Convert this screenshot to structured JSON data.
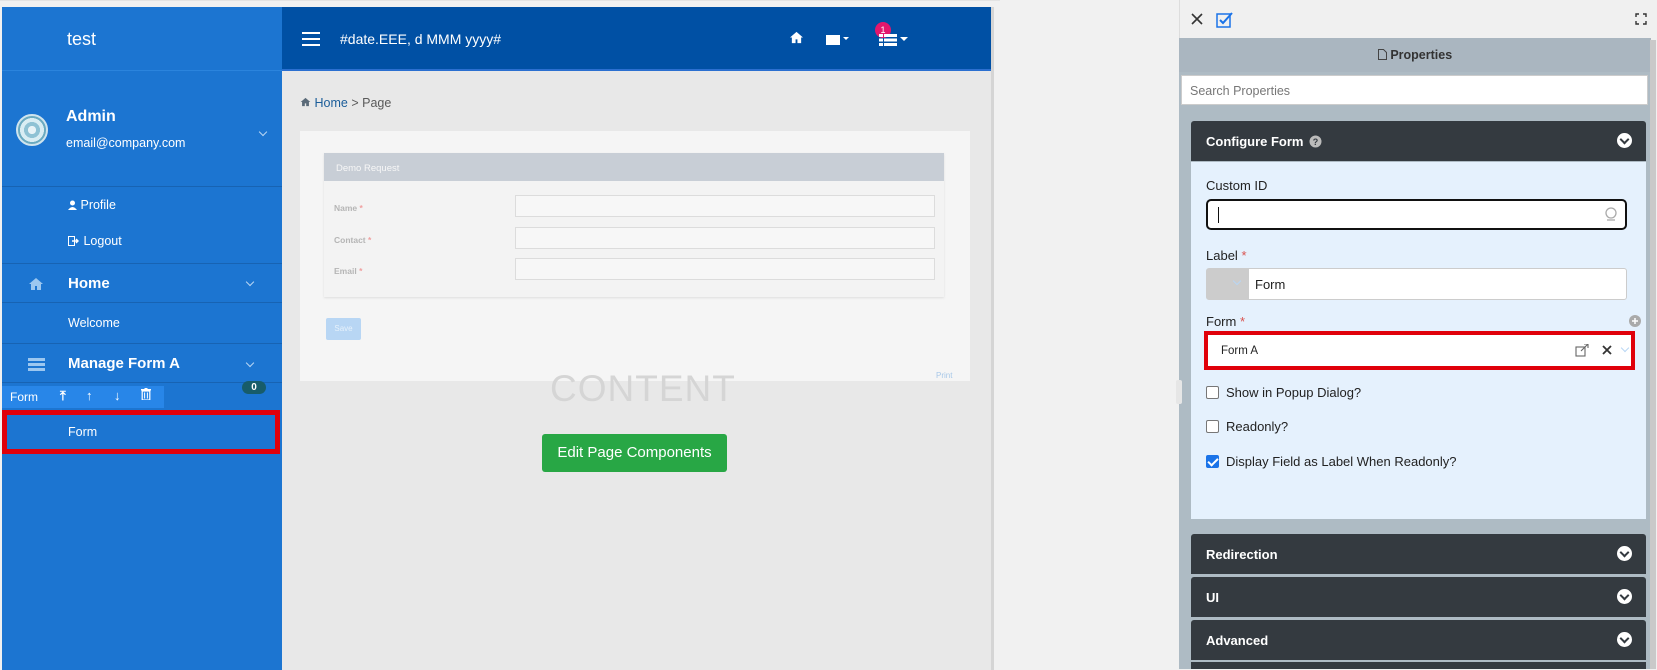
{
  "app": {
    "brand": "test",
    "user": {
      "name": "Admin",
      "email": "email@company.com"
    },
    "user_menu": [
      {
        "label": "Profile"
      },
      {
        "label": "Logout"
      }
    ],
    "nav": [
      {
        "label": "Home",
        "children": [
          "Welcome"
        ]
      },
      {
        "label": "Manage Form A"
      }
    ],
    "badge_count": "0",
    "component_toolbar_label": "Form",
    "selected_item": "Form",
    "topbar": {
      "date_format": "#date.EEE, d MMM yyyy#",
      "notification_count": "1"
    },
    "breadcrumb": {
      "home": "Home",
      "sep": ">",
      "current": "Page"
    },
    "preview": {
      "card_title": "Demo Request",
      "fields": [
        {
          "label": "Name"
        },
        {
          "label": "Contact"
        },
        {
          "label": "Email"
        }
      ],
      "required_mark": "*",
      "save_label": "Save",
      "print_label": "Print",
      "ghost_text": "CONTENT"
    },
    "edit_button": "Edit Page Components"
  },
  "props": {
    "title": "Properties",
    "search_placeholder": "Search Properties",
    "configure_title": "Configure Form",
    "custom_id_label": "Custom ID",
    "custom_id_value": "",
    "label_label": "Label",
    "label_value": "Form",
    "form_label": "Form",
    "form_value": "Form A",
    "checks": [
      {
        "label": "Show in Popup Dialog?",
        "checked": false
      },
      {
        "label": "Readonly?",
        "checked": false
      },
      {
        "label": "Display Field as Label When Readonly?",
        "checked": true
      }
    ],
    "sections": [
      "Redirection",
      "UI",
      "Advanced"
    ]
  }
}
